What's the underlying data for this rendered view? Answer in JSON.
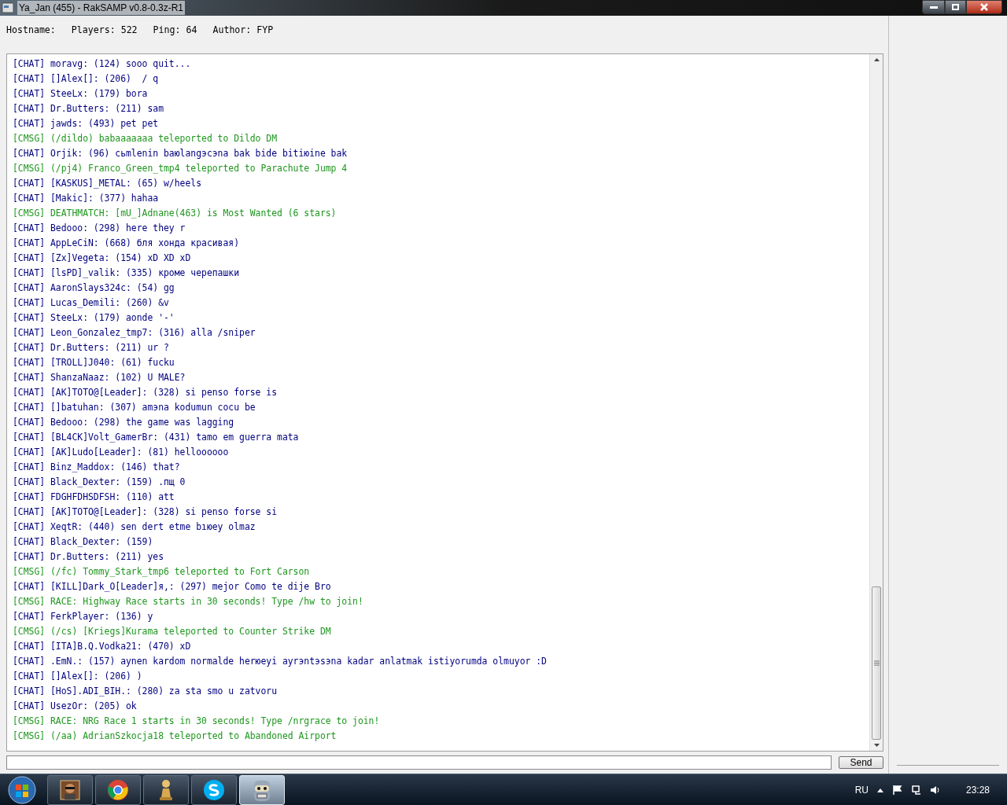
{
  "window": {
    "title": "Ya_Jan (455) - RakSAMP v0.8-0.3z-R1"
  },
  "info_bar": [
    "Hostname:",
    "Players: 522",
    "Ping: 64",
    "Author: FYP"
  ],
  "chat_log": [
    {
      "kind": "chat",
      "text": "[CHAT] moravg: (124) sooo quit..."
    },
    {
      "kind": "chat",
      "text": "[CHAT] []Alex[]: (206)  / q"
    },
    {
      "kind": "chat",
      "text": "[CHAT] SteeLx: (179) bora"
    },
    {
      "kind": "chat",
      "text": "[CHAT] Dr.Butters: (211) sam"
    },
    {
      "kind": "chat",
      "text": "[CHAT] jawds: (493) pet pet"
    },
    {
      "kind": "cmsg",
      "text": "[CMSG] (/dildo) babaaaaaaa teleported to Dildo DM"
    },
    {
      "kind": "chat",
      "text": "[CHAT] Orjik: (96) cьmlenin baюlangэcэna bak bide bitiюine bak"
    },
    {
      "kind": "cmsg",
      "text": "[CMSG] (/pj4) Franco_Green_tmp4 teleported to Parachute Jump 4"
    },
    {
      "kind": "chat",
      "text": "[CHAT] [KASKUS]_METAL: (65) w/heels"
    },
    {
      "kind": "chat",
      "text": "[CHAT] [Makic]: (377) hahaa"
    },
    {
      "kind": "cmsg",
      "text": "[CMSG] DEATHMATCH: [mU_]Adnane(463) is Most Wanted (6 stars)"
    },
    {
      "kind": "chat",
      "text": "[CHAT] Bedooo: (298) here they r"
    },
    {
      "kind": "chat",
      "text": "[CHAT] AppLeCiN: (668) бля хонда красивая)"
    },
    {
      "kind": "chat",
      "text": "[CHAT] [Zx]Vegeta: (154) xD XD xD"
    },
    {
      "kind": "chat",
      "text": "[CHAT] [lsPD]_valik: (335) кроме черепашки"
    },
    {
      "kind": "chat",
      "text": "[CHAT] AaronSlays324c: (54) gg"
    },
    {
      "kind": "chat",
      "text": "[CHAT] Lucas_Demili: (260) &v"
    },
    {
      "kind": "chat",
      "text": "[CHAT] SteeLx: (179) aonde '-'"
    },
    {
      "kind": "chat",
      "text": "[CHAT] Leon_Gonzalez_tmp7: (316) alla /sniper"
    },
    {
      "kind": "chat",
      "text": "[CHAT] Dr.Butters: (211) ur ?"
    },
    {
      "kind": "chat",
      "text": "[CHAT] [TROLL]J040: (61) fucku"
    },
    {
      "kind": "chat",
      "text": "[CHAT] ShanzaNaaz: (102) U MALE?"
    },
    {
      "kind": "chat",
      "text": "[CHAT] [AK]TOTO@[Leader]: (328) si penso forse is"
    },
    {
      "kind": "chat",
      "text": "[CHAT] []batuhan: (307) amэna kodumun cocu be"
    },
    {
      "kind": "chat",
      "text": "[CHAT] Bedooo: (298) the game was lagging"
    },
    {
      "kind": "chat",
      "text": "[CHAT] [BL4CK]Volt_GamerBr: (431) tamo em guerra mata"
    },
    {
      "kind": "chat",
      "text": "[CHAT] [AK]Ludo[Leader]: (81) helloooooo"
    },
    {
      "kind": "chat",
      "text": "[CHAT] Binz_Maddox: (146) that?"
    },
    {
      "kind": "chat",
      "text": "[CHAT] Black_Dexter: (159) .пщ 0"
    },
    {
      "kind": "chat",
      "text": "[CHAT] FDGHFDHSDFSH: (110) att"
    },
    {
      "kind": "chat",
      "text": "[CHAT] [AK]TOTO@[Leader]: (328) si penso forse si"
    },
    {
      "kind": "chat",
      "text": "[CHAT] XeqtR: (440) sen dert etme bıюey olmaz"
    },
    {
      "kind": "chat",
      "text": "[CHAT] Black_Dexter: (159)"
    },
    {
      "kind": "chat",
      "text": "[CHAT] Dr.Butters: (211) yes"
    },
    {
      "kind": "cmsg",
      "text": "[CMSG] (/fc) Tommy_Stark_tmp6 teleported to Fort Carson"
    },
    {
      "kind": "chat",
      "text": "[CHAT] [KILL]Dark_O[Leader]я,: (297) mejor Como te dije Bro"
    },
    {
      "kind": "cmsg",
      "text": "[CMSG] RACE: Highway Race starts in 30 seconds! Type /hw to join!"
    },
    {
      "kind": "chat",
      "text": "[CHAT] FerkPlayer: (136) y"
    },
    {
      "kind": "cmsg",
      "text": "[CMSG] (/cs) [Kriegs]Kurama teleported to Counter Strike DM"
    },
    {
      "kind": "chat",
      "text": "[CHAT] [ITA]B.Q.Vodka21: (470) xD"
    },
    {
      "kind": "chat",
      "text": "[CHAT] .EmN.: (157) aynen kardom normalde herюeyi ayrэntэsэna kadar anlatmak istiyorumda olmuyor :D"
    },
    {
      "kind": "chat",
      "text": "[CHAT] []Alex[]: (206) )"
    },
    {
      "kind": "chat",
      "text": "[CHAT] [HoS].ADI_BIH.: (280) za sta smo u zatvoru"
    },
    {
      "kind": "chat",
      "text": "[CHAT] UsezOr: (205) ok"
    },
    {
      "kind": "cmsg",
      "text": "[CMSG] RACE: NRG Race 1 starts in 30 seconds! Type /nrgrace to join!"
    },
    {
      "kind": "cmsg",
      "text": "[CMSG] (/aa) AdrianSzkocja18 teleported to Abandoned Airport"
    }
  ],
  "send_button": "Send",
  "taskbar": {
    "apps": [
      {
        "selected": false
      },
      {
        "selected": false
      },
      {
        "selected": false
      },
      {
        "selected": false
      },
      {
        "selected": true
      }
    ],
    "language": "RU",
    "clock": "23:28"
  }
}
